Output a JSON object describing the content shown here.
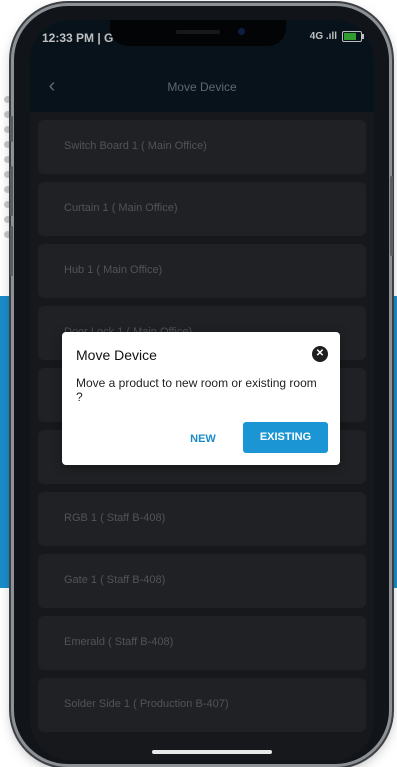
{
  "status_bar": {
    "time": "12:33 PM | G",
    "right_text": "4G .ıll"
  },
  "app_bar": {
    "title": "Move Device",
    "back_icon": "chevron-left-icon"
  },
  "devices": [
    {
      "label": "Switch Board 1 ( Main Office)"
    },
    {
      "label": "Curtain 1 ( Main Office)"
    },
    {
      "label": "Hub 1 ( Main Office)"
    },
    {
      "label": "Door Lock 1 ( Main Office)"
    },
    {
      "label": ""
    },
    {
      "label": ""
    },
    {
      "label": "RGB 1 ( Staff B-408)"
    },
    {
      "label": "Gate 1 ( Staff B-408)"
    },
    {
      "label": "Emerald ( Staff B-408)"
    },
    {
      "label": "Solder Side 1 ( Production B-407)"
    }
  ],
  "dialog": {
    "title": "Move Device",
    "message": "Move a product to new room or existing room ?",
    "new_label": "NEW",
    "existing_label": "EXISTING",
    "close_icon": "close-circle-icon"
  },
  "colors": {
    "accent": "#1b95d4",
    "appbar_bg": "#0a1925",
    "screen_bg": "#1f2124",
    "band_bg": "#1b8cc9"
  }
}
